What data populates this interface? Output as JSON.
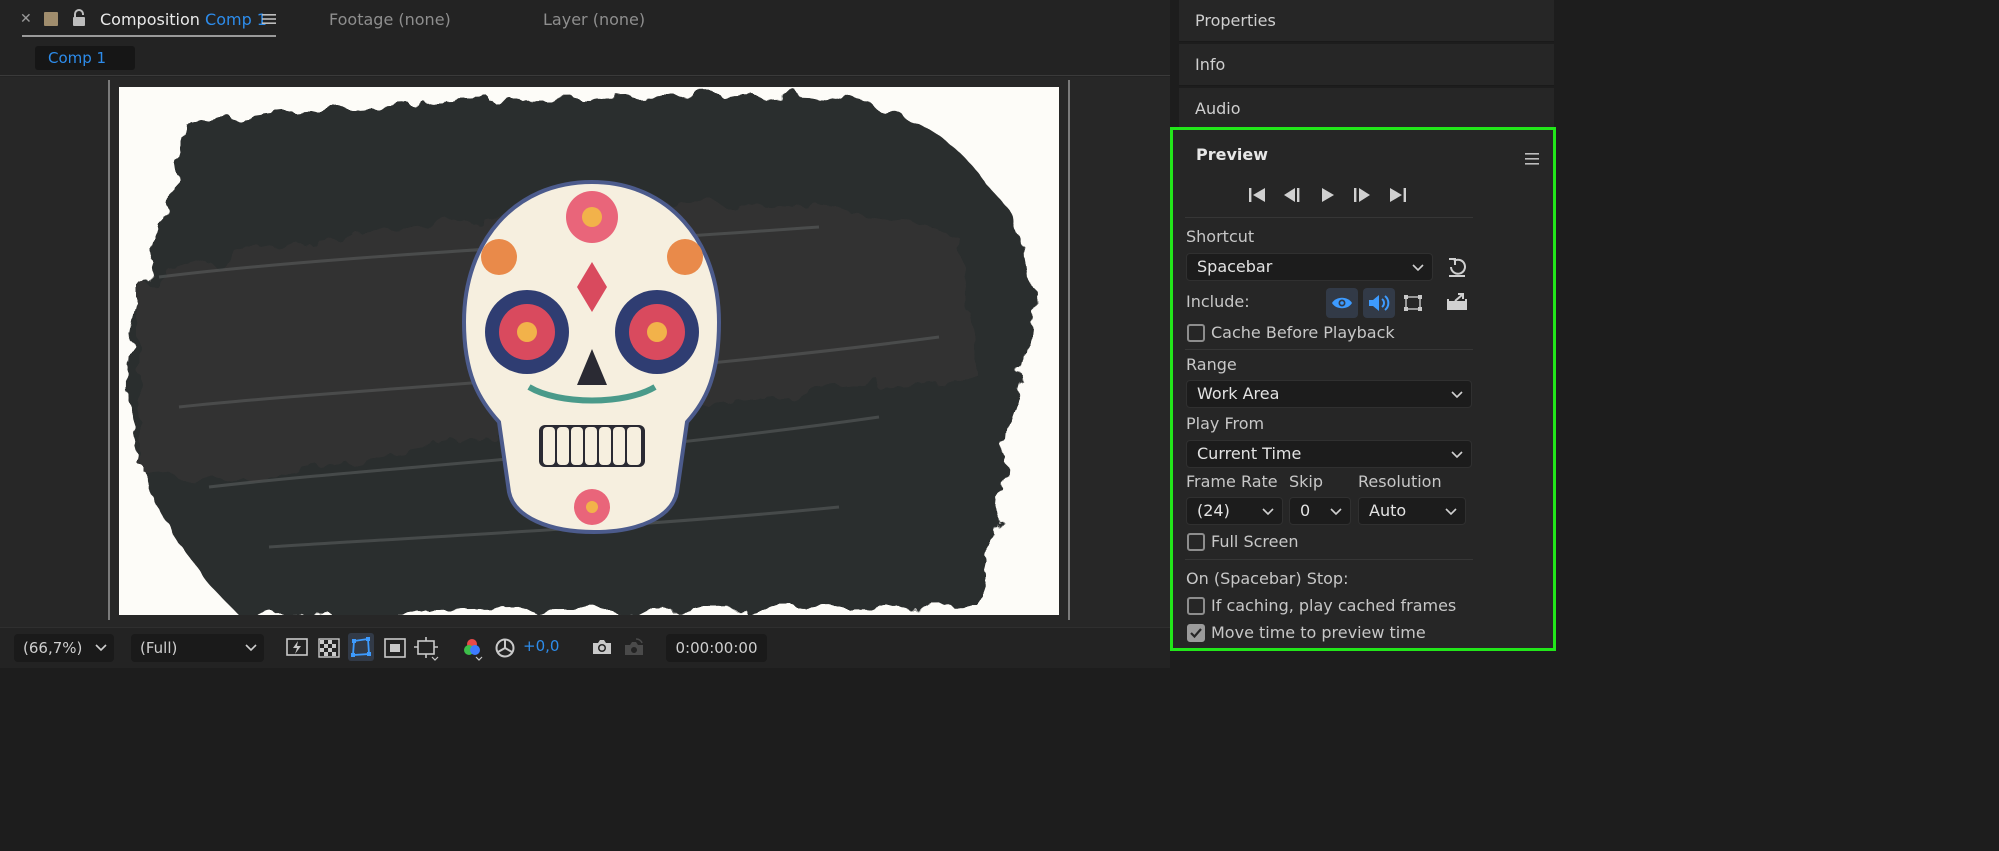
{
  "composition_panel": {
    "tab_prefix": "Composition",
    "tab_comp_name": "Comp 1",
    "footage_label": "Footage (none)",
    "layer_label": "Layer (none)",
    "comp_chip": "Comp 1"
  },
  "viewer_toolbar": {
    "zoom": "(66,7%)",
    "resolution": "(Full)",
    "exposure": "+0,0",
    "timecode": "0:00:00:00"
  },
  "right_panels": {
    "properties": "Properties",
    "info": "Info",
    "audio": "Audio"
  },
  "preview": {
    "title": "Preview",
    "shortcut_label": "Shortcut",
    "shortcut_value": "Spacebar",
    "include_label": "Include:",
    "cache_before_playback": {
      "label": "Cache Before Playback",
      "checked": false
    },
    "range_label": "Range",
    "range_value": "Work Area",
    "play_from_label": "Play From",
    "play_from_value": "Current Time",
    "frame_rate_label": "Frame Rate",
    "frame_rate_value": "(24)",
    "skip_label": "Skip",
    "skip_value": "0",
    "resolution_label": "Resolution",
    "resolution_value": "Auto",
    "full_screen": {
      "label": "Full Screen",
      "checked": false
    },
    "on_stop_label": "On (Spacebar) Stop:",
    "if_caching": {
      "label": "If caching, play cached frames",
      "checked": false
    },
    "move_time": {
      "label": "Move time to preview time",
      "checked": true
    }
  },
  "colors": {
    "accent_blue": "#2d8ceb",
    "highlight_frame": "#22e61a",
    "panel_bg": "#262626",
    "canvas_bg": "#fdfcf8"
  }
}
